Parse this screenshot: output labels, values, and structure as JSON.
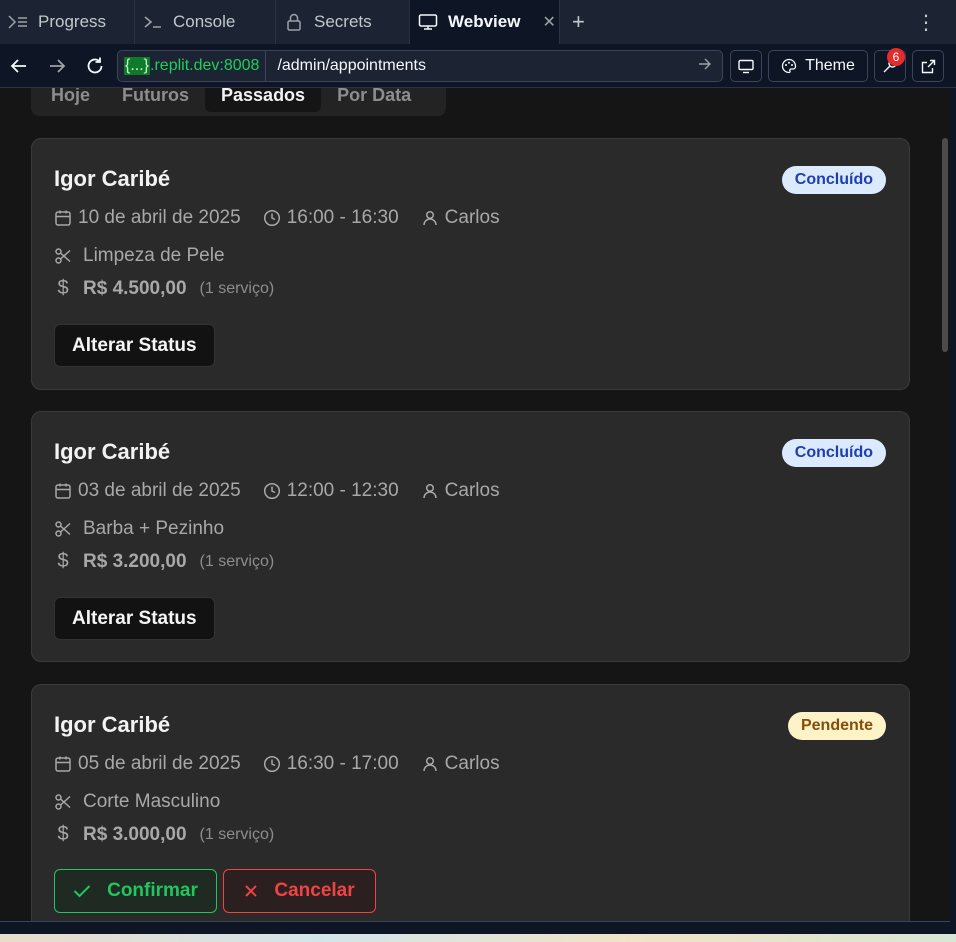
{
  "tabs": [
    {
      "label": "Progress",
      "icon": "progress-icon"
    },
    {
      "label": "Console",
      "icon": "terminal-icon"
    },
    {
      "label": "Secrets",
      "icon": "lock-icon"
    },
    {
      "label": "Webview",
      "icon": "monitor-icon"
    }
  ],
  "url": {
    "host_highlight": "{...}",
    "host_rest": ".replit.dev:8008",
    "path": "/admin/appointments"
  },
  "toolbar": {
    "theme_label": "Theme",
    "devtools_badge": "6"
  },
  "filters": [
    "Hoje",
    "Futuros",
    "Passados",
    "Por Data"
  ],
  "appointments": [
    {
      "client": "Igor Caribé",
      "status": "Concluído",
      "date": "10 de abril de 2025",
      "time": "16:00 - 16:30",
      "barber": "Carlos",
      "service": "Limpeza de Pele",
      "price": "R$ 4.500,00",
      "count": "(1 serviço)",
      "action": "Alterar Status"
    },
    {
      "client": "Igor Caribé",
      "status": "Concluído",
      "date": "03 de abril de 2025",
      "time": "12:00 - 12:30",
      "barber": "Carlos",
      "service": "Barba + Pezinho",
      "price": "R$ 3.200,00",
      "count": "(1 serviço)",
      "action": "Alterar Status"
    },
    {
      "client": "Igor Caribé",
      "status": "Pendente",
      "date": "05 de abril de 2025",
      "time": "16:30 - 17:00",
      "barber": "Carlos",
      "service": "Corte Masculino",
      "price": "R$ 3.000,00",
      "count": "(1 serviço)",
      "confirm": "Confirmar",
      "cancel": "Cancelar"
    }
  ]
}
